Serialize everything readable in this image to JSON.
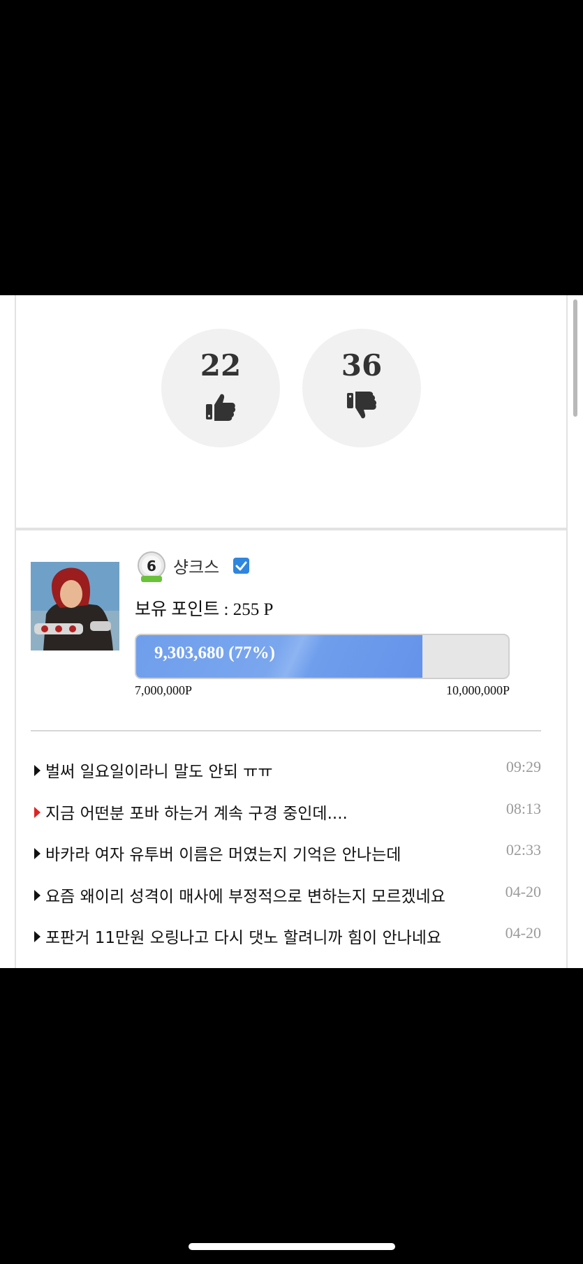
{
  "votes": {
    "up_count": "22",
    "down_count": "36",
    "up_icon": "thumbs-up-icon",
    "down_icon": "thumbs-down-icon"
  },
  "profile": {
    "level": "6",
    "username": "샹크스",
    "verified_icon": "check-icon",
    "points_label": "보유 포인트 : 255 P",
    "progress": {
      "text": "9,303,680 (77%)",
      "fraction": 0.77,
      "min_label": "7,000,000P",
      "max_label": "10,000,000P"
    }
  },
  "posts": [
    {
      "title": "벌써 일요일이라니 말도 안되 ㅠㅠ",
      "time": "09:29",
      "marker": "#111111"
    },
    {
      "title": "지금 어떤분 포바 하는거 계속 구경 중인데....",
      "time": "08:13",
      "marker": "#e02424"
    },
    {
      "title": "바카라 여자 유투버 이름은 머였는지 기억은 안나는데",
      "time": "02:33",
      "marker": "#111111"
    },
    {
      "title": "요즘 왜이리 성격이 매사에 부정적으로 변하는지 모르겠네요",
      "time": "04-20",
      "marker": "#111111"
    },
    {
      "title": "포판거 11만원 오링나고 다시 댓노 할려니까 힘이 안나네요",
      "time": "04-20",
      "marker": "#111111"
    }
  ],
  "colors": {
    "progress_fill": "#6f9eec",
    "vote_bg": "#f1f1f1",
    "accent_blue": "#2e86de",
    "marker_red": "#e02424"
  }
}
